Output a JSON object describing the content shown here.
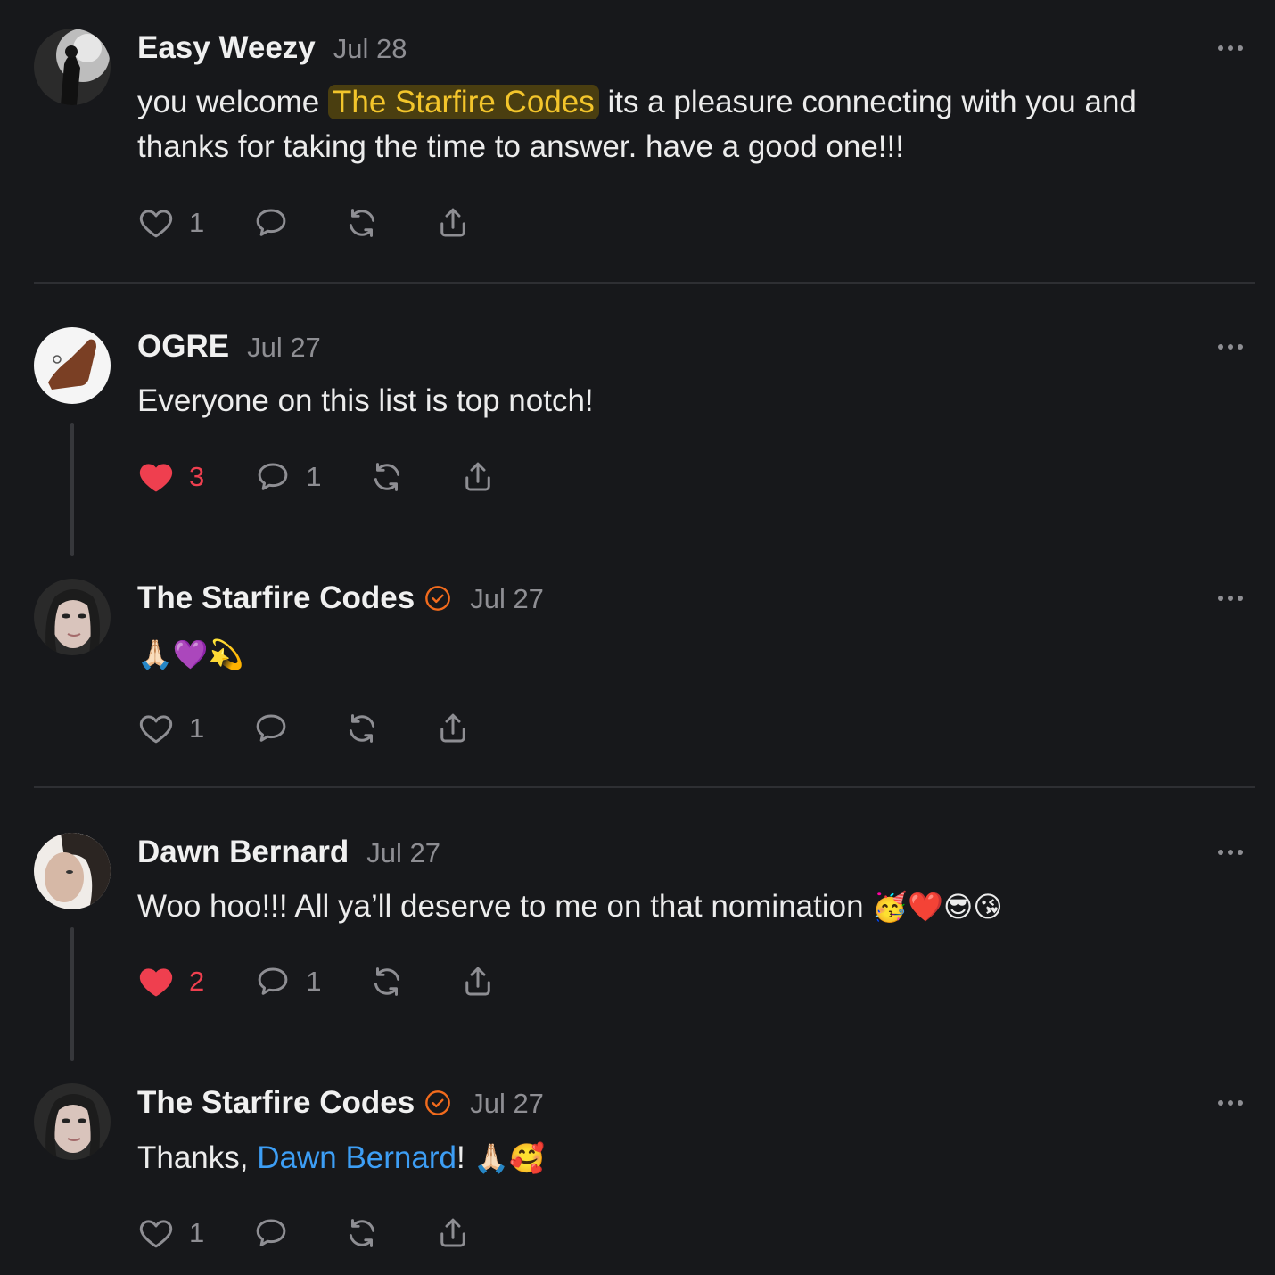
{
  "comments": [
    {
      "name": "Easy Weezy",
      "date": "Jul 28",
      "text_before": "you welcome ",
      "mention": "The Starfire Codes",
      "text_after": " its a pleasure connecting with you and thanks for taking the time to answer. have a good one!!!",
      "likes": "1",
      "liked": false
    },
    {
      "name": "OGRE",
      "date": "Jul 27",
      "text": "Everyone on this list is top notch!",
      "likes": "3",
      "replies": "1",
      "liked": true
    },
    {
      "name": "The Starfire Codes",
      "date": "Jul 27",
      "text": "🙏🏻💜💫",
      "likes": "1",
      "liked": false
    },
    {
      "name": "Dawn Bernard",
      "date": "Jul 27",
      "text": "Woo hoo!!! All ya’ll deserve to me on that nomination ",
      "emoji": "🥳❤️😎😘",
      "likes": "2",
      "replies": "1",
      "liked": true
    },
    {
      "name": "The Starfire Codes",
      "date": "Jul 27",
      "text_before": "Thanks, ",
      "mention": "Dawn Bernard",
      "text_after": "! ",
      "emoji": "🙏🏻🥰",
      "likes": "1",
      "liked": false
    }
  ],
  "colors": {
    "background": "#17181b",
    "mention_highlight": "#f3c52b",
    "link": "#3d9ef5",
    "liked_heart": "#ef3f4f",
    "verified_badge": "#f26b1d",
    "muted": "#8e8e93"
  },
  "icons": [
    "heart-icon",
    "comment-icon",
    "repost-icon",
    "share-icon",
    "more-icon",
    "verified-icon"
  ]
}
